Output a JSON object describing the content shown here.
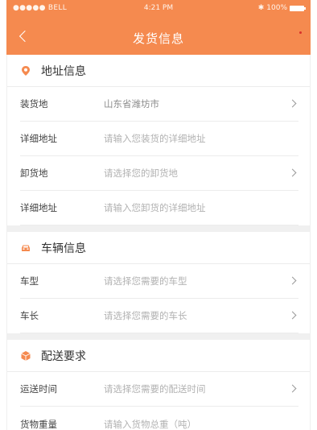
{
  "status_bar": {
    "carrier": "●●●●● BELL",
    "time": "4:21 PM",
    "battery": "100%"
  },
  "header": {
    "title": "发货信息"
  },
  "sections": [
    {
      "title": "地址信息",
      "icon": "location-icon",
      "rows": [
        {
          "label": "装货地",
          "value": "山东省潍坊市"
        },
        {
          "label": "详细地址",
          "value": "请输入您装货的详细地址"
        },
        {
          "label": "卸货地",
          "value": "请选择您的卸货地"
        },
        {
          "label": "详细地址",
          "value": "请输入您卸货的详细地址"
        }
      ]
    },
    {
      "title": "车辆信息",
      "icon": "car-icon",
      "rows": [
        {
          "label": "车型",
          "value": "请选择您需要的车型"
        },
        {
          "label": "车长",
          "value": "请选择您需要的车长"
        }
      ]
    },
    {
      "title": "配送要求",
      "icon": "package-icon",
      "rows": [
        {
          "label": "运送时间",
          "value": "请选择您需要的配送时间"
        },
        {
          "label": "货物重量",
          "value": "请输入货物总重（吨）"
        }
      ]
    }
  ],
  "colors": {
    "accent": "#f58a4f"
  }
}
